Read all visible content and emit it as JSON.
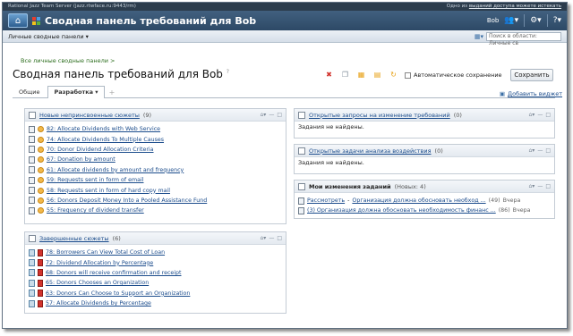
{
  "window": {
    "server_title": "Rational Jazz Team Server (jazz.rtwface.ru:9443/rm)",
    "top_links": "Одно из ",
    "top_links_link": "выданий доступа можете истекать"
  },
  "titlebar": {
    "title": "Сводная панель требований для Bob",
    "user": "Bob",
    "colors": {
      "bar": "#2d4966",
      "glyph": [
        "#e53e2f",
        "#4c9be0",
        "#f2c21a",
        "#5ab43c"
      ]
    }
  },
  "subbar": {
    "personal_dashboards": "Личные сводные панели",
    "search_placeholder": "Поиск в области: Личные св"
  },
  "page": {
    "breadcrumb": "Все личные сводные панели >",
    "title": "Сводная панель требований для Bob",
    "help": "?",
    "autosave_label": "Автоматическое сохранение",
    "save_label": "Сохранить",
    "tabs": [
      {
        "label": "Общие"
      },
      {
        "label": "Разработка"
      }
    ],
    "tab_dropdown": "▾",
    "add_widget_label": "Добавить виджет"
  },
  "widgets": {
    "new_stories": {
      "title": "Новые непринсвоенные сюжеты",
      "count": "(9)",
      "items": [
        "82: Allocate Dividends with Web Service",
        "74: Allocate Dividends To Multiple Causes",
        "70: Donor Dividend Allocation Criteria",
        "67: Donation by amount",
        "61: Allocate dividends by amount and frequency",
        "59: Requests sent in form of email",
        "58: Requests sent in form of hard copy mail",
        "56: Donors Deposit Money Into a Pooled Assistance Fund",
        "55: Frequency of dividend transfer"
      ]
    },
    "done_stories": {
      "title": "Завершенные сюжеты",
      "count": "(6)",
      "items": [
        "78: Borrowers Can View Total Cost of Loan",
        "72: Dividend Allocation by Percentage",
        "68: Donors will receive confirmation and receipt",
        "65: Donors Chooses an Organization",
        "63: Donors Can Choose to Support an Organization",
        "57: Allocate Dividends by Percentage"
      ]
    },
    "change_requests": {
      "title": "Открытые запросы на изменение требований",
      "count": "(0)",
      "empty": "Задания не найдены."
    },
    "impact_tasks": {
      "title": "Открытые задачи анализа воздействия",
      "count": "(0)",
      "empty": "Задания не найдены."
    },
    "my_changes": {
      "title": "Мои изменения заданий",
      "count": "(Новых: 4)",
      "rows": [
        {
          "type": "Рассмотреть",
          "sep": " - ",
          "text": "Организация должна обосновать необход ...",
          "count": "(49)",
          "when": "Вчера"
        },
        {
          "type": "",
          "sep": "",
          "text": "(3) Организация должна обосновать необходимость финанс ...",
          "count": "(86)",
          "when": "Вчера"
        }
      ]
    }
  }
}
